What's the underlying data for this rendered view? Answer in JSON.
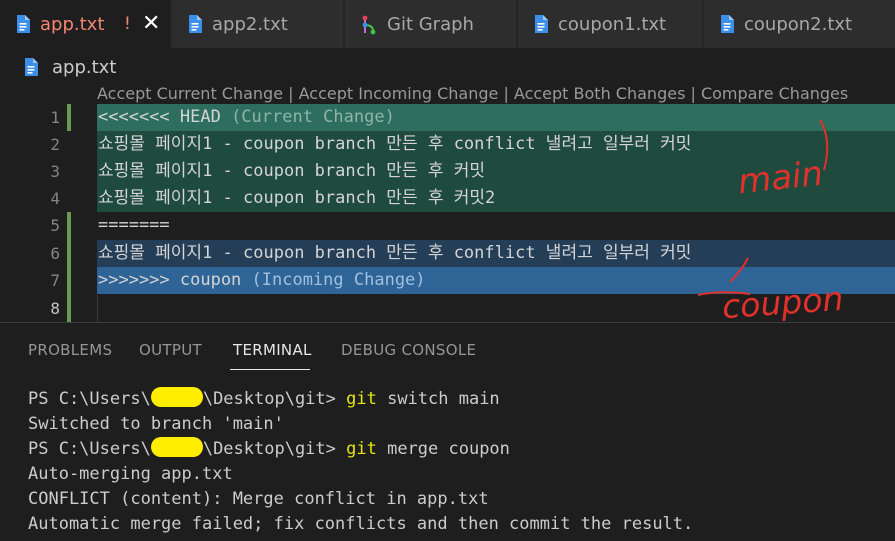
{
  "tabs": [
    {
      "label": "app.txt",
      "modified": "!",
      "close": "✕"
    },
    {
      "label": "app2.txt"
    },
    {
      "label": "Git Graph"
    },
    {
      "label": "coupon1.txt"
    },
    {
      "label": "coupon2.txt"
    }
  ],
  "breadcrumb": {
    "file": "app.txt"
  },
  "codelens": {
    "accept_current": "Accept Current Change",
    "accept_incoming": "Accept Incoming Change",
    "accept_both": "Accept Both Changes",
    "compare": "Compare Changes",
    "separator": " | "
  },
  "lines": [
    {
      "num": "1",
      "marker": "<<<<<<< HEAD",
      "hint": " (Current Change)"
    },
    {
      "num": "2",
      "text": "쇼핑몰 페이지1 - coupon branch 만든 후 conflict 낼려고 일부러 커밋"
    },
    {
      "num": "3",
      "text": "쇼핑몰 페이지1 - coupon branch 만든 후 커밋"
    },
    {
      "num": "4",
      "text": "쇼핑몰 페이지1 - coupon branch 만든 후 커밋2"
    },
    {
      "num": "5",
      "text": "======="
    },
    {
      "num": "6",
      "text": "쇼핑몰 페이지1 - coupon branch 만든 후 conflict 낼려고 일부러 커밋"
    },
    {
      "num": "7",
      "marker": ">>>>>>> coupon",
      "hint": " (Incoming Change)"
    },
    {
      "num": "8",
      "text": ""
    }
  ],
  "annotations": {
    "main": "main",
    "coupon": "coupon"
  },
  "panel": {
    "tabs": [
      "PROBLEMS",
      "OUTPUT",
      "TERMINAL",
      "DEBUG CONSOLE"
    ],
    "active_tab": "TERMINAL"
  },
  "terminal": {
    "prompt_prefix": "PS C:\\Users\\",
    "prompt_suffix": "\\Desktop\\git> ",
    "cmd1_git": "git",
    "cmd1_rest": " switch main",
    "out1": "Switched to branch 'main'",
    "cmd2_git": "git",
    "cmd2_rest": " merge coupon",
    "out2": "Auto-merging app.txt",
    "out3": "CONFLICT (content): Merge conflict in app.txt",
    "out4": "Automatic merge failed; fix conflicts and then commit the result."
  },
  "colors": {
    "current_header": "#2d6e5e",
    "current_body": "#1f4a3e",
    "incoming_body": "#243e58",
    "incoming_header": "#2f6497",
    "git_keyword": "#e5e510",
    "annotation": "#e0312b"
  }
}
